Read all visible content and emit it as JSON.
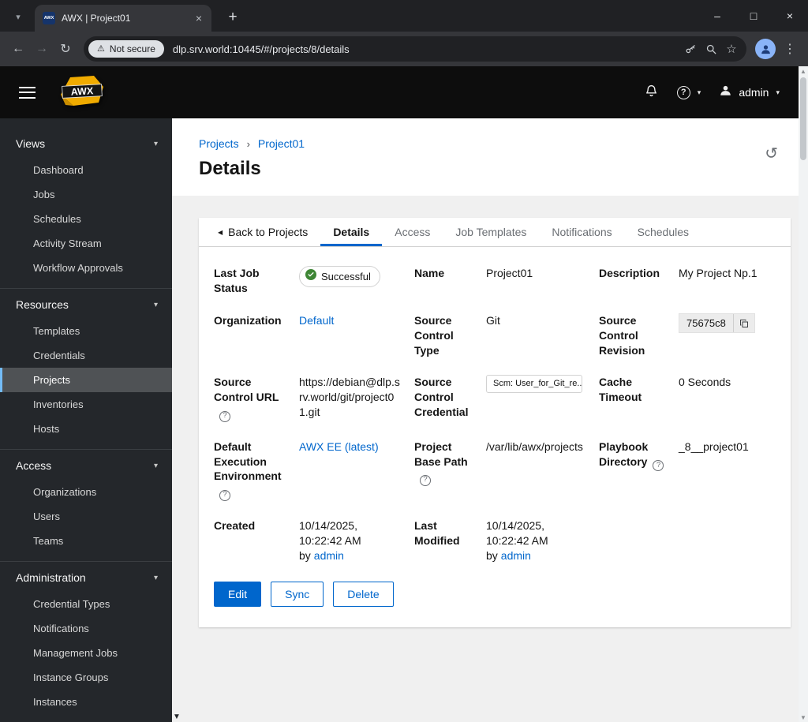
{
  "icons": {
    "tab_search": "▾",
    "tab_close": "×",
    "new_tab": "+",
    "minimize": "–",
    "maximize": "□",
    "close": "×",
    "back": "←",
    "forward": "→",
    "reload": "↻",
    "warning": "⚠",
    "star": "☆",
    "menu_dots": "⋮",
    "chevron_down": "▾",
    "breadcrumb_sep": "›",
    "back_caret": "◀",
    "history": "↺",
    "help": "?",
    "triangle_down": "▼",
    "triangle_up": "▲",
    "favicon_text": "AWX"
  },
  "browser": {
    "tab_title": "AWX | Project01",
    "security_label": "Not secure",
    "url": "dlp.srv.world:10445/#/projects/8/details"
  },
  "awx_header": {
    "logo": "AWX",
    "user": "admin"
  },
  "sidebar": {
    "sections": [
      {
        "label": "Views",
        "items": [
          "Dashboard",
          "Jobs",
          "Schedules",
          "Activity Stream",
          "Workflow Approvals"
        ]
      },
      {
        "label": "Resources",
        "items": [
          "Templates",
          "Credentials",
          "Projects",
          "Inventories",
          "Hosts"
        ]
      },
      {
        "label": "Access",
        "items": [
          "Organizations",
          "Users",
          "Teams"
        ]
      },
      {
        "label": "Administration",
        "items": [
          "Credential Types",
          "Notifications",
          "Management Jobs",
          "Instance Groups",
          "Instances"
        ]
      }
    ],
    "active_item": "Projects"
  },
  "page": {
    "breadcrumb": {
      "parent": "Projects",
      "current": "Project01"
    },
    "title": "Details",
    "tabs": {
      "back": "Back to Projects",
      "details": "Details",
      "access": "Access",
      "job_templates": "Job Templates",
      "notifications": "Notifications",
      "schedules": "Schedules"
    }
  },
  "details": {
    "last_job_status": {
      "term": "Last Job Status",
      "value": "Successful"
    },
    "name": {
      "term": "Name",
      "value": "Project01"
    },
    "description": {
      "term": "Description",
      "value": "My Project Np.1"
    },
    "organization": {
      "term": "Organization",
      "value": "Default"
    },
    "scm_type": {
      "term": "Source Control Type",
      "value": "Git"
    },
    "scm_revision": {
      "term": "Source Control Revision",
      "value": "75675c8"
    },
    "scm_url": {
      "term": "Source Control URL",
      "value": "https://debian@dlp.srv.world/git/project01.git"
    },
    "scm_credential": {
      "term": "Source Control Credential",
      "value": "Scm: User_for_Git_re..."
    },
    "cache_timeout": {
      "term": "Cache Timeout",
      "value": "0 Seconds"
    },
    "default_ee": {
      "term": "Default Execution Environment",
      "value": "AWX EE (latest)"
    },
    "base_path": {
      "term": "Project Base Path",
      "value": "/var/lib/awx/projects"
    },
    "playbook_dir": {
      "term": "Playbook Directory",
      "value": "_8__project01"
    },
    "created": {
      "term": "Created",
      "value": "10/14/2025, 10:22:42 AM by",
      "user": "admin"
    },
    "modified": {
      "term": "Last Modified",
      "value": "10/14/2025, 10:22:42 AM by",
      "user": "admin"
    }
  },
  "actions": {
    "edit": "Edit",
    "sync": "Sync",
    "delete": "Delete"
  }
}
